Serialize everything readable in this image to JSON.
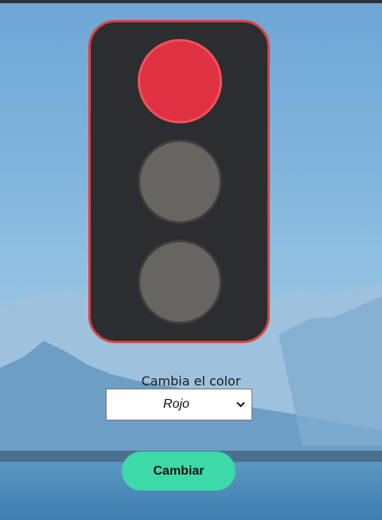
{
  "traffic_light": {
    "active_light": "red",
    "colors": {
      "housing": "#2b2d30",
      "border": "#d9443f",
      "red_on": "#e03142",
      "off": "#676562"
    }
  },
  "control": {
    "label": "Cambia el color",
    "selected_option": "Rojo",
    "button_label": "Cambiar",
    "button_color": "#3dd9a9"
  }
}
